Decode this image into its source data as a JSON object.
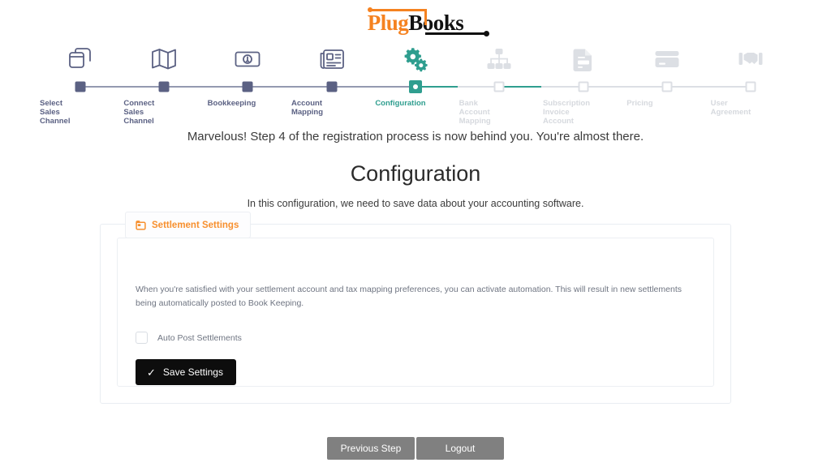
{
  "brand": {
    "name_part1": "Plug",
    "name_part2": "Books"
  },
  "stepper": {
    "steps": [
      {
        "label": "Select\nSales\nChannel",
        "icon": "copy-icon",
        "state": "done"
      },
      {
        "label": "Connect\nSales\nChannel",
        "icon": "map-icon",
        "state": "done"
      },
      {
        "label": "Bookkeeping",
        "icon": "banknote-icon",
        "state": "done"
      },
      {
        "label": "Account\nMapping",
        "icon": "newspaper-icon",
        "state": "done"
      },
      {
        "label": "Configuration",
        "icon": "gears-icon",
        "state": "active"
      },
      {
        "label": "Bank\nAccount\nMapping",
        "icon": "sitemap-icon",
        "state": "todo"
      },
      {
        "label": "Subscription\nInvoice\nAccount",
        "icon": "invoice-file-icon",
        "state": "todo"
      },
      {
        "label": "Pricing",
        "icon": "credit-card-icon",
        "state": "todo"
      },
      {
        "label": "User\nAgreement",
        "icon": "handshake-icon",
        "state": "todo"
      }
    ],
    "colors": {
      "done": "#5b6183",
      "active": "#2f9e8f",
      "todo": "#dcdfe4"
    }
  },
  "intro_message": "Marvelous! Step 4 of the registration process is now behind you. You're almost there.",
  "page": {
    "title": "Configuration",
    "subtitle": "In this configuration, we need to save data about your accounting software."
  },
  "card": {
    "tab_label": "Settlement Settings",
    "tab_icon": "folder-window-icon",
    "tab_color": "#f7902e",
    "description": "When you're satisfied with your settlement account and tax mapping preferences, you can activate automation. This will result in new settlements being automatically posted to Book Keeping.",
    "checkbox": {
      "label": "Auto Post Settlements",
      "checked": false
    },
    "save_button": {
      "label": "Save Settings",
      "icon": "check-icon"
    }
  },
  "footer": {
    "previous_label": "Previous Step",
    "logout_label": "Logout"
  }
}
